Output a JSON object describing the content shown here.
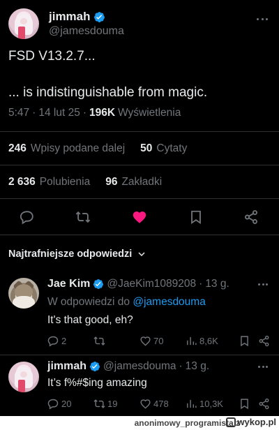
{
  "main_tweet": {
    "author_name": "jimmah",
    "author_handle": "@jamesdouma",
    "line1": "FSD V13.2.7...",
    "line2": "... is indistinguishable from magic.",
    "time": "5:47",
    "date": "14 lut 25",
    "views_count": "196K",
    "views_label": "Wyświetlenia"
  },
  "stats": {
    "reposts_count": "246",
    "reposts_label": "Wpisy podane dalej",
    "quotes_count": "50",
    "quotes_label": "Cytaty",
    "likes_count": "2 636",
    "likes_label": "Polubienia",
    "bookmarks_count": "96",
    "bookmarks_label": "Zakładki"
  },
  "replies_header": "Najtrafniejsze odpowiedzi",
  "replies": [
    {
      "name": "Jae Kim",
      "handle": "@JaeKim1089208",
      "time": "13 g.",
      "reply_to_prefix": "W odpowiedzi do",
      "reply_to_handle": "@jamesdouma",
      "text": "It's that good, eh?",
      "replies": "2",
      "reposts": "",
      "likes": "70",
      "views": "8,6K"
    },
    {
      "name": "jimmah",
      "handle": "@jamesdouma",
      "time": "13 g.",
      "text": "It’s f%#$ing amazing",
      "replies": "20",
      "reposts": "19",
      "likes": "478",
      "views": "10,3K"
    }
  ],
  "footer": {
    "username": "anonimowy_programista",
    "suffix": "z",
    "site": "wykop.pl"
  },
  "colors": {
    "background": "#000000",
    "text": "#e7e9ea",
    "muted": "#71767b",
    "accent": "#1d9bf0",
    "like": "#f91880",
    "divider": "#2f3336"
  },
  "icons": [
    "verified-badge-icon",
    "more-icon",
    "reply-icon",
    "repost-icon",
    "like-icon",
    "bookmark-icon",
    "share-icon",
    "views-icon",
    "chevron-down-icon"
  ]
}
